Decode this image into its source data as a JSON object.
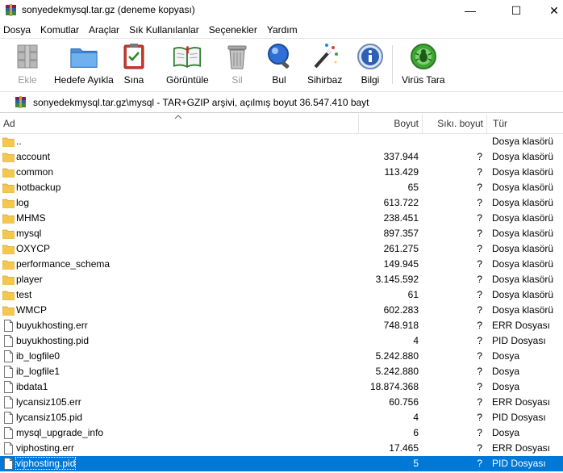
{
  "window": {
    "title": "sonyedekmysql.tar.gz (deneme kopyası)",
    "minimize_glyph": "—",
    "maximize_glyph": "☐",
    "close_glyph": "✕"
  },
  "menu": [
    "Dosya",
    "Komutlar",
    "Araçlar",
    "Sık Kullanılanlar",
    "Seçenekler",
    "Yardım"
  ],
  "toolbar": {
    "add": "Ekle",
    "extract": "Hedefe Ayıkla",
    "test": "Sına",
    "view": "Görüntüle",
    "delete": "Sil",
    "find": "Bul",
    "wizard": "Sihirbaz",
    "info": "Bilgi",
    "virus": "Virüs Tara"
  },
  "address": {
    "path": "sonyedekmysql.tar.gz\\mysql - TAR+GZIP arşivi, açılmış boyut 36.547.410 bayt"
  },
  "columns": {
    "name": "Ad",
    "size": "Boyut",
    "packed": "Sıkı. boyut",
    "type": "Tür"
  },
  "colors": {
    "folder": "#f5c84c",
    "selection": "#0078d7"
  },
  "rows": [
    {
      "name": "..",
      "size": "",
      "packed": "",
      "type": "Dosya klasörü",
      "icon": "folder-icon"
    },
    {
      "name": "account",
      "size": "337.944",
      "packed": "?",
      "type": "Dosya klasörü",
      "icon": "folder-icon"
    },
    {
      "name": "common",
      "size": "113.429",
      "packed": "?",
      "type": "Dosya klasörü",
      "icon": "folder-icon"
    },
    {
      "name": "hotbackup",
      "size": "65",
      "packed": "?",
      "type": "Dosya klasörü",
      "icon": "folder-icon"
    },
    {
      "name": "log",
      "size": "613.722",
      "packed": "?",
      "type": "Dosya klasörü",
      "icon": "folder-icon"
    },
    {
      "name": "MHMS",
      "size": "238.451",
      "packed": "?",
      "type": "Dosya klasörü",
      "icon": "folder-icon"
    },
    {
      "name": "mysql",
      "size": "897.357",
      "packed": "?",
      "type": "Dosya klasörü",
      "icon": "folder-icon"
    },
    {
      "name": "OXYCP",
      "size": "261.275",
      "packed": "?",
      "type": "Dosya klasörü",
      "icon": "folder-icon"
    },
    {
      "name": "performance_schema",
      "size": "149.945",
      "packed": "?",
      "type": "Dosya klasörü",
      "icon": "folder-icon"
    },
    {
      "name": "player",
      "size": "3.145.592",
      "packed": "?",
      "type": "Dosya klasörü",
      "icon": "folder-icon"
    },
    {
      "name": "test",
      "size": "61",
      "packed": "?",
      "type": "Dosya klasörü",
      "icon": "folder-icon"
    },
    {
      "name": "WMCP",
      "size": "602.283",
      "packed": "?",
      "type": "Dosya klasörü",
      "icon": "folder-icon"
    },
    {
      "name": "buyukhosting.err",
      "size": "748.918",
      "packed": "?",
      "type": "ERR Dosyası",
      "icon": "file-icon"
    },
    {
      "name": "buyukhosting.pid",
      "size": "4",
      "packed": "?",
      "type": "PID Dosyası",
      "icon": "file-icon"
    },
    {
      "name": "ib_logfile0",
      "size": "5.242.880",
      "packed": "?",
      "type": "Dosya",
      "icon": "file-icon"
    },
    {
      "name": "ib_logfile1",
      "size": "5.242.880",
      "packed": "?",
      "type": "Dosya",
      "icon": "file-icon"
    },
    {
      "name": "ibdata1",
      "size": "18.874.368",
      "packed": "?",
      "type": "Dosya",
      "icon": "file-icon"
    },
    {
      "name": "lycansiz105.err",
      "size": "60.756",
      "packed": "?",
      "type": "ERR Dosyası",
      "icon": "file-icon"
    },
    {
      "name": "lycansiz105.pid",
      "size": "4",
      "packed": "?",
      "type": "PID Dosyası",
      "icon": "file-icon"
    },
    {
      "name": "mysql_upgrade_info",
      "size": "6",
      "packed": "?",
      "type": "Dosya",
      "icon": "file-icon"
    },
    {
      "name": "viphosting.err",
      "size": "17.465",
      "packed": "?",
      "type": "ERR Dosyası",
      "icon": "file-icon"
    },
    {
      "name": "viphosting.pid",
      "size": "5",
      "packed": "?",
      "type": "PID Dosyası",
      "icon": "file-icon",
      "selected": true
    }
  ]
}
